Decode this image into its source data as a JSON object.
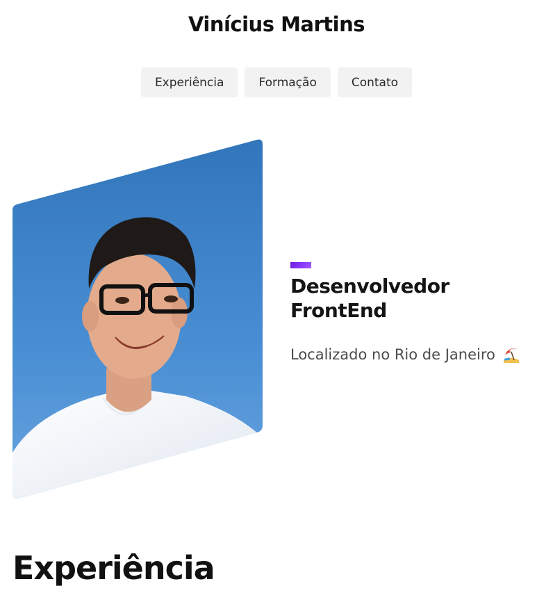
{
  "header": {
    "name": "Vinícius Martins"
  },
  "nav": {
    "items": [
      {
        "label": "Experiência"
      },
      {
        "label": "Formação"
      },
      {
        "label": "Contato"
      }
    ]
  },
  "hero": {
    "role_line1": "Desenvolvedor",
    "role_line2": "FrontEnd",
    "location": "Localizado no Rio de Janeiro",
    "location_icon": "beach-umbrella-icon",
    "accent_color": "#7b2cf0"
  },
  "sections": {
    "experience_heading": "Experiência"
  },
  "colors": {
    "nav_bg": "#f2f2f2",
    "sky": "#3d7fc4",
    "text": "#141414"
  }
}
